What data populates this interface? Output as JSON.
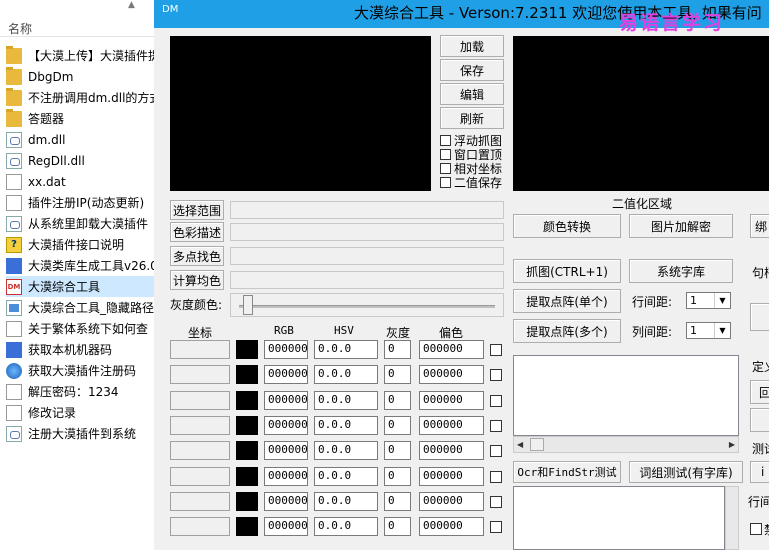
{
  "explorer": {
    "header": "名称",
    "items": [
      {
        "label": "【大漠上传】大漠插件提",
        "icon": "folder-icon"
      },
      {
        "label": "DbgDm",
        "icon": "folder-icon"
      },
      {
        "label": "不注册调用dm.dll的方式",
        "icon": "folder-icon"
      },
      {
        "label": "答题器",
        "icon": "folder-icon"
      },
      {
        "label": "dm.dll",
        "icon": "dll-icon"
      },
      {
        "label": "RegDll.dll",
        "icon": "dll-icon"
      },
      {
        "label": "xx.dat",
        "icon": "file-icon"
      },
      {
        "label": "插件注册IP(动态更新)",
        "icon": "document-icon"
      },
      {
        "label": "从系统里卸载大漠插件",
        "icon": "dll-icon"
      },
      {
        "label": "大漠插件接口说明",
        "icon": "help-icon"
      },
      {
        "label": "大漠类库生成工具v26.0",
        "icon": "app-icon"
      },
      {
        "label": "大漠综合工具",
        "icon": "dm-icon"
      },
      {
        "label": "大漠综合工具_隐藏路径",
        "icon": "window-icon"
      },
      {
        "label": "关于繁体系统下如何查",
        "icon": "document-icon"
      },
      {
        "label": "获取本机机器码",
        "icon": "app-icon"
      },
      {
        "label": "获取大漠插件注册码",
        "icon": "globe-icon"
      },
      {
        "label": "解压密码：1234",
        "icon": "document-icon"
      },
      {
        "label": "修改记录",
        "icon": "document-icon"
      },
      {
        "label": "注册大漠插件到系统",
        "icon": "dll-icon"
      }
    ],
    "selected_index": 11
  },
  "app": {
    "title_logo": "DM",
    "title": "大漠综合工具 - Verson:7.2311  欢迎您使用本工具, 如果有问",
    "watermark": "易语言学习",
    "buttons": {
      "load": "加载",
      "save": "保存",
      "edit": "编辑",
      "refresh": "刷新"
    },
    "checkboxes": {
      "float_capture": "浮动抓图",
      "window_top": "窗口置顶",
      "relative_coords": "相对坐标",
      "binary_save": "二值保存"
    },
    "left_buttons": {
      "select_range": "选择范围",
      "color_desc": "色彩描述",
      "multi_find": "多点找色",
      "calc_avg": "计算均色"
    },
    "gray_color_label": "灰度颜色:",
    "table_headers": {
      "coord": "坐标",
      "rgb": "RGB",
      "hsv": "HSV",
      "gray": "灰度",
      "offset": "偏色"
    },
    "rows": [
      {
        "rgb": "000000",
        "hsv": "0.0.0",
        "gray": "0",
        "offset": "000000"
      },
      {
        "rgb": "000000",
        "hsv": "0.0.0",
        "gray": "0",
        "offset": "000000"
      },
      {
        "rgb": "000000",
        "hsv": "0.0.0",
        "gray": "0",
        "offset": "000000"
      },
      {
        "rgb": "000000",
        "hsv": "0.0.0",
        "gray": "0",
        "offset": "000000"
      },
      {
        "rgb": "000000",
        "hsv": "0.0.0",
        "gray": "0",
        "offset": "000000"
      },
      {
        "rgb": "000000",
        "hsv": "0.0.0",
        "gray": "0",
        "offset": "000000"
      },
      {
        "rgb": "000000",
        "hsv": "0.0.0",
        "gray": "0",
        "offset": "000000"
      },
      {
        "rgb": "000000",
        "hsv": "0.0.0",
        "gray": "0",
        "offset": "000000"
      }
    ],
    "binarize_label": "二值化区域",
    "right_buttons": {
      "color_convert": "颜色转换",
      "image_encrypt": "图片加解密",
      "capture": "抓图(CTRL+1)",
      "sys_font": "系统字库",
      "extract_single": "提取点阵(单个)",
      "extract_multi": "提取点阵(多个)",
      "ocr_test": "Ocr和FindStr测试",
      "word_test": "词组测试(有字库)"
    },
    "row_spacing_label": "行间距:",
    "col_spacing_label": "列间距:",
    "row_spacing_value": "1",
    "col_spacing_value": "1",
    "cut_right": {
      "c1": "绑",
      "c2": "句柄",
      "c3": "定义",
      "c4": "回",
      "c5": "测试",
      "c6": "i",
      "c7": "行间",
      "c8": "禁"
    }
  }
}
